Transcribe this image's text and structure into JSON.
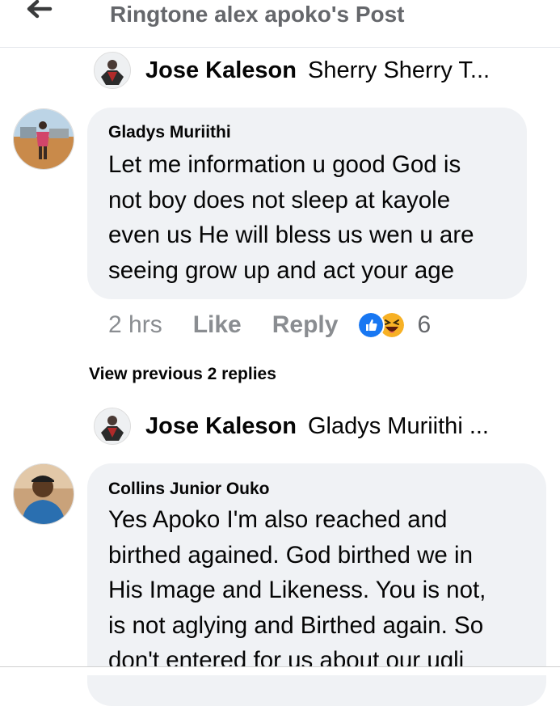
{
  "header": {
    "title": "Ringtone alex apoko's Post"
  },
  "replies": [
    {
      "name": "Jose Kaleson",
      "text": "Sherry Sherry T..."
    },
    {
      "name": "Jose Kaleson",
      "text": "Gladys Muriithi ..."
    }
  ],
  "comments": [
    {
      "author": "Gladys Muriithi",
      "lines": [
        "Let me information u good God is",
        "not boy does not sleep at kayole",
        "even us He will bless us wen u are",
        "seeing grow up and act your age"
      ],
      "time": "2 hrs",
      "like_label": "Like",
      "reply_label": "Reply",
      "reactions": [
        "like",
        "haha"
      ],
      "reaction_count": "6"
    },
    {
      "author": "Collins Junior Ouko",
      "lines": [
        "Yes Apoko I'm also reached and",
        "birthed agained. God birthed we in",
        "His Image and Likeness. You is not,",
        "is not aglying and Birthed again. So",
        "don't entered for us about our ugli"
      ]
    }
  ],
  "view_previous": "View previous 2 replies",
  "icons": {
    "back": "arrow-left-icon",
    "like_reaction": "like-reaction-icon",
    "haha_reaction": "haha-reaction-icon"
  },
  "colors": {
    "bubble": "#f0f2f5",
    "like_blue": "#1877f2",
    "haha_yellow": "#f7b125",
    "muted": "#65676b"
  }
}
